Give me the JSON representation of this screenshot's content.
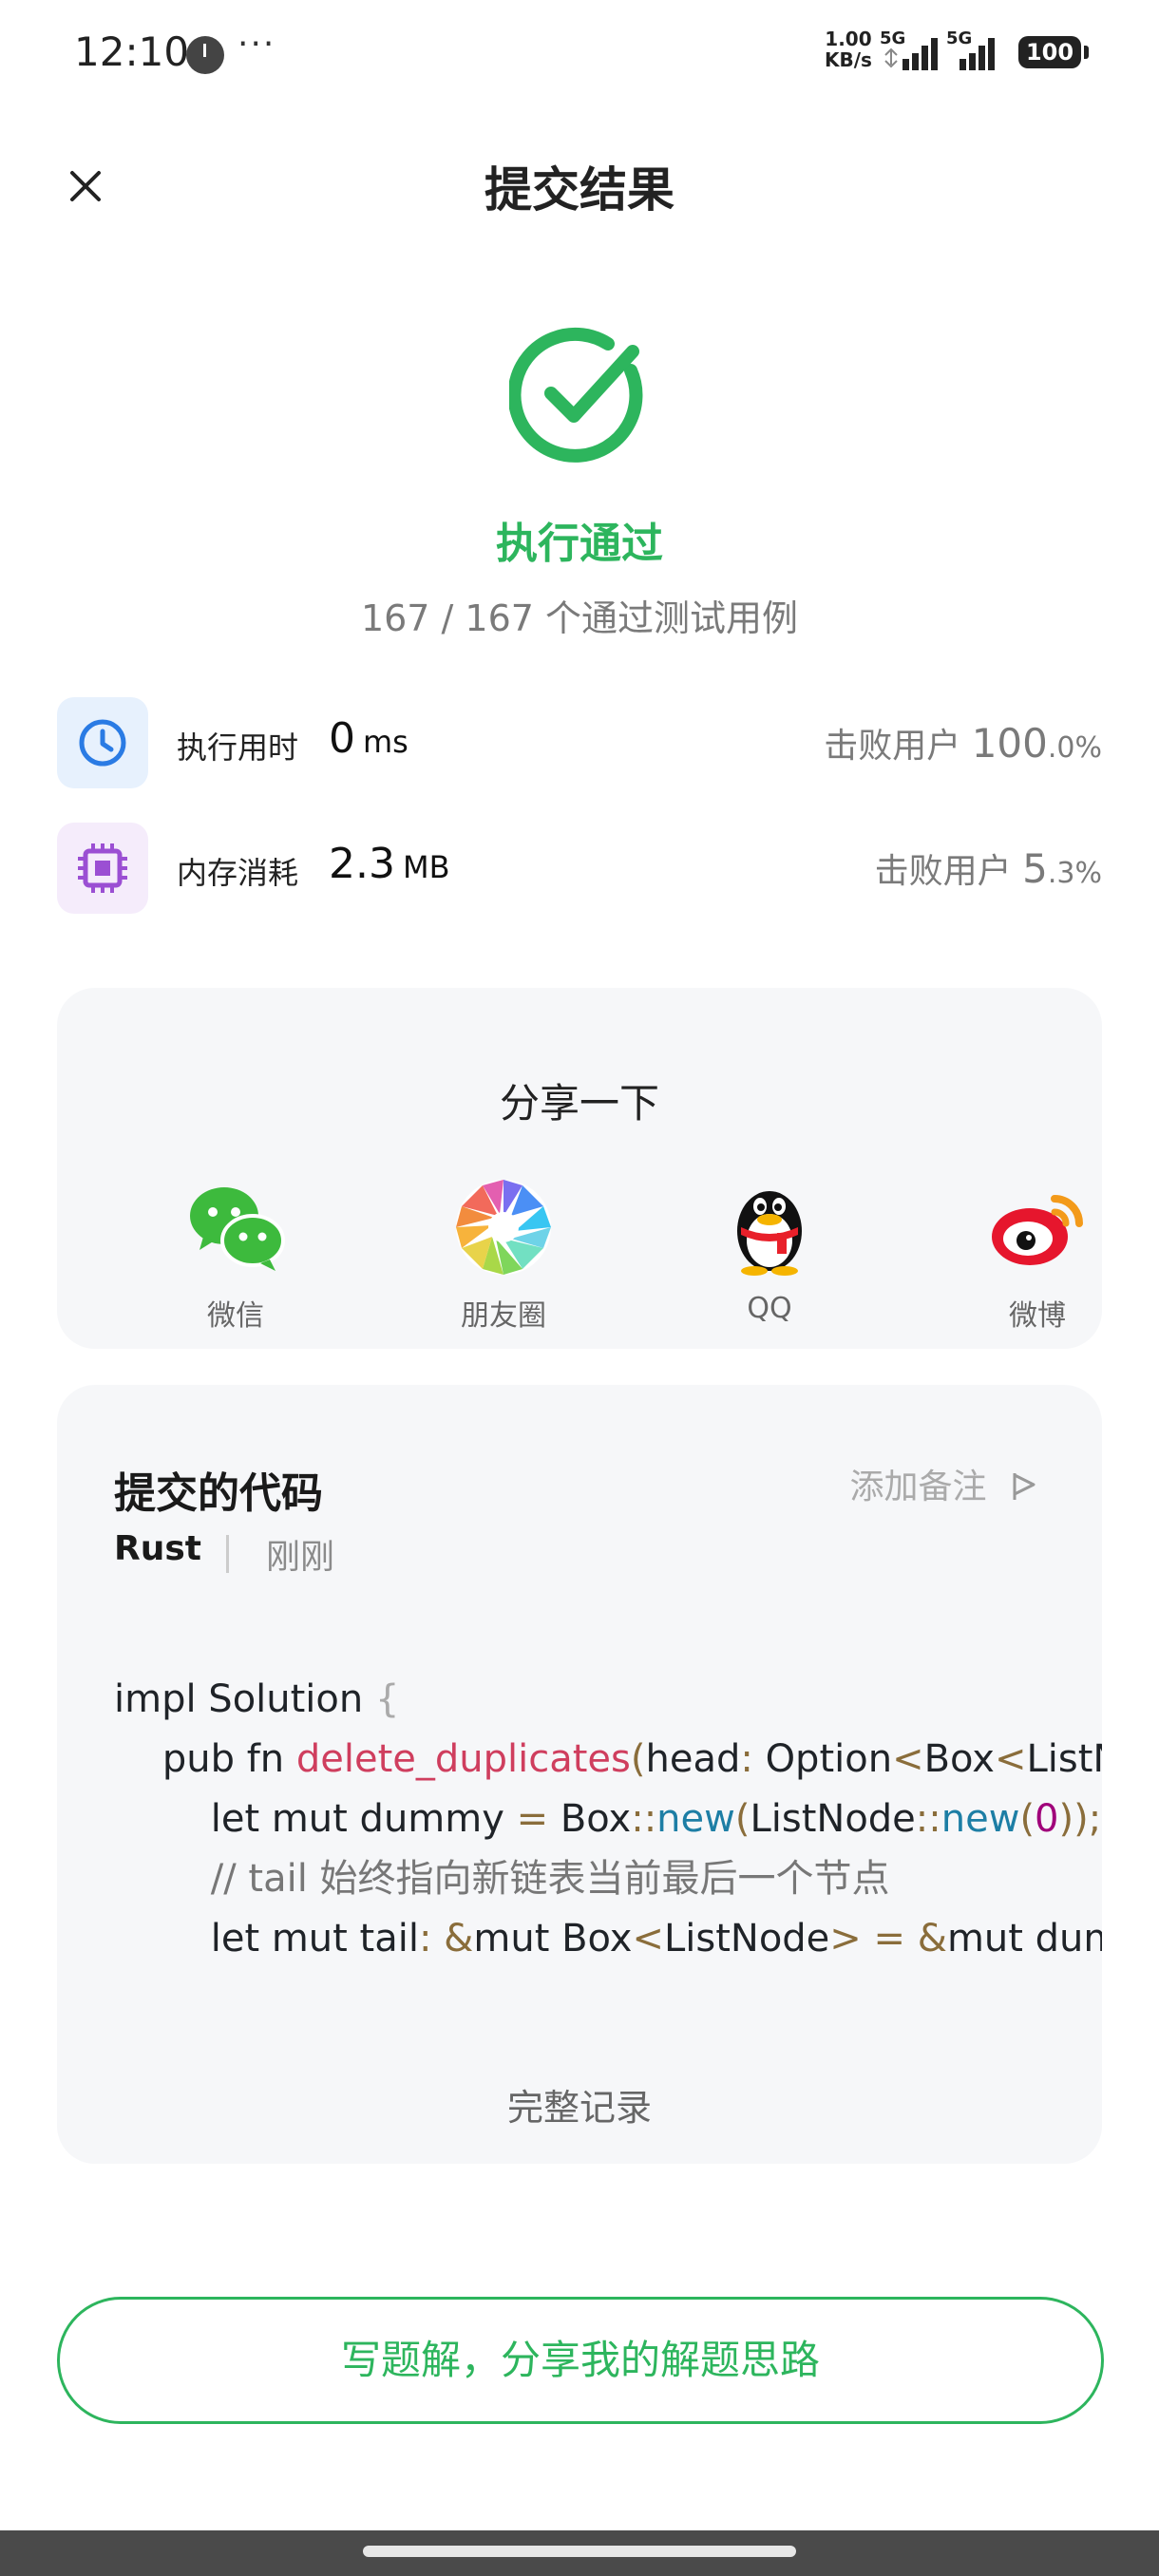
{
  "status_bar": {
    "time": "12:10",
    "more": "···",
    "net_speed_value": "1.00",
    "net_speed_unit": "KB/s",
    "sim1_label": "5G",
    "sim2_label": "5G",
    "battery": "100"
  },
  "header": {
    "title": "提交结果"
  },
  "result": {
    "status": "执行通过",
    "passed": "167 / 167 个通过测试用例",
    "accent": "#2db55d"
  },
  "stats": {
    "runtime": {
      "label": "执行用时",
      "value": "0",
      "unit": "ms",
      "beat_label": "击败用户",
      "beat_int": "100",
      "beat_frac": ".0%"
    },
    "memory": {
      "label": "内存消耗",
      "value": "2.3",
      "unit": "MB",
      "beat_label": "击败用户",
      "beat_int": "5",
      "beat_frac": ".3%"
    }
  },
  "share": {
    "title": "分享一下",
    "items": [
      {
        "label": "微信",
        "icon": "wechat-icon"
      },
      {
        "label": "朋友圈",
        "icon": "moments-icon"
      },
      {
        "label": "QQ",
        "icon": "qq-icon"
      },
      {
        "label": "微博",
        "icon": "weibo-icon"
      }
    ]
  },
  "code": {
    "title": "提交的代码",
    "add_note": "添加备注",
    "language": "Rust",
    "time_ago": "刚刚",
    "lines": {
      "l1a": "impl Solution ",
      "l1b": "{",
      "l2a": "    pub fn ",
      "l2b": "delete_duplicates",
      "l2c": "(",
      "l2d": "head",
      "l2e": ": ",
      "l2f": "Option",
      "l2g": "<",
      "l2h": "Box",
      "l2i": "<",
      "l2j": "ListNode",
      "l3a": "        let mut dummy ",
      "l3b": "= ",
      "l3c": "Box",
      "l3d": "::",
      "l3e": "new",
      "l3f": "(",
      "l3g": "ListNode",
      "l3h": "::",
      "l3i": "new",
      "l3j": "(",
      "l3k": "0",
      "l3l": "));",
      "l4": "        // tail 始终指向新链表当前最后一个节点",
      "l5a": "        let mut tail",
      "l5b": ": &",
      "l5c": "mut Box",
      "l5d": "<",
      "l5e": "ListNode",
      "l5f": "> = &",
      "l5g": "mut dummy"
    },
    "full_record": "完整记录"
  },
  "cta": {
    "label": "写题解，分享我的解题思路"
  }
}
